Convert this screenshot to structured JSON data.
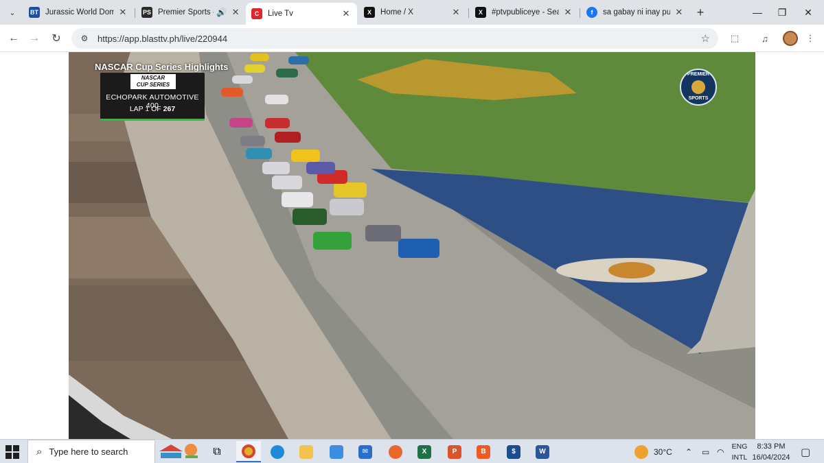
{
  "browser": {
    "tabs": [
      {
        "title": "Jurassic World Domin",
        "favicon": "BT",
        "favicon_color": "#1e4aa8"
      },
      {
        "title": "Premier Sports - E",
        "favicon": "PS",
        "favicon_color": "#2a2a2a",
        "audio": true
      },
      {
        "title": "Live Tv",
        "favicon": "C",
        "favicon_color": "#e0262e",
        "active": true
      },
      {
        "title": "Home / X",
        "favicon": "X",
        "favicon_color": "#111111"
      },
      {
        "title": "#ptvpubliceye - Searc",
        "favicon": "X",
        "favicon_color": "#111111"
      },
      {
        "title": "sa gabay ni inay publ",
        "favicon": "f",
        "favicon_color": "#1877f2"
      }
    ],
    "new_tab_label": "+",
    "url": "https://app.blasttv.ph/live/220944"
  },
  "video": {
    "show_title": "NASCAR Cup Series Highlights",
    "series_logo_top": "NASCAR",
    "series_logo_bottom": "CUP SERIES",
    "race_name": "ECHOPARK AUTOMOTIVE 400",
    "lap_prefix": "LAP 1 OF",
    "lap_total": "267",
    "broadcaster_top": "PREMIER",
    "broadcaster_bottom": "SPORTS",
    "colors": {
      "score_accent": "#23c436",
      "infield_grass": "#5f8a3c",
      "apron_blue": "#2d4f86"
    }
  },
  "taskbar": {
    "search_placeholder": "Type here to search",
    "weather": "30°C",
    "language_top": "ENG",
    "language_bottom": "INTL",
    "time": "8:33 PM",
    "date": "16/04/2024"
  }
}
